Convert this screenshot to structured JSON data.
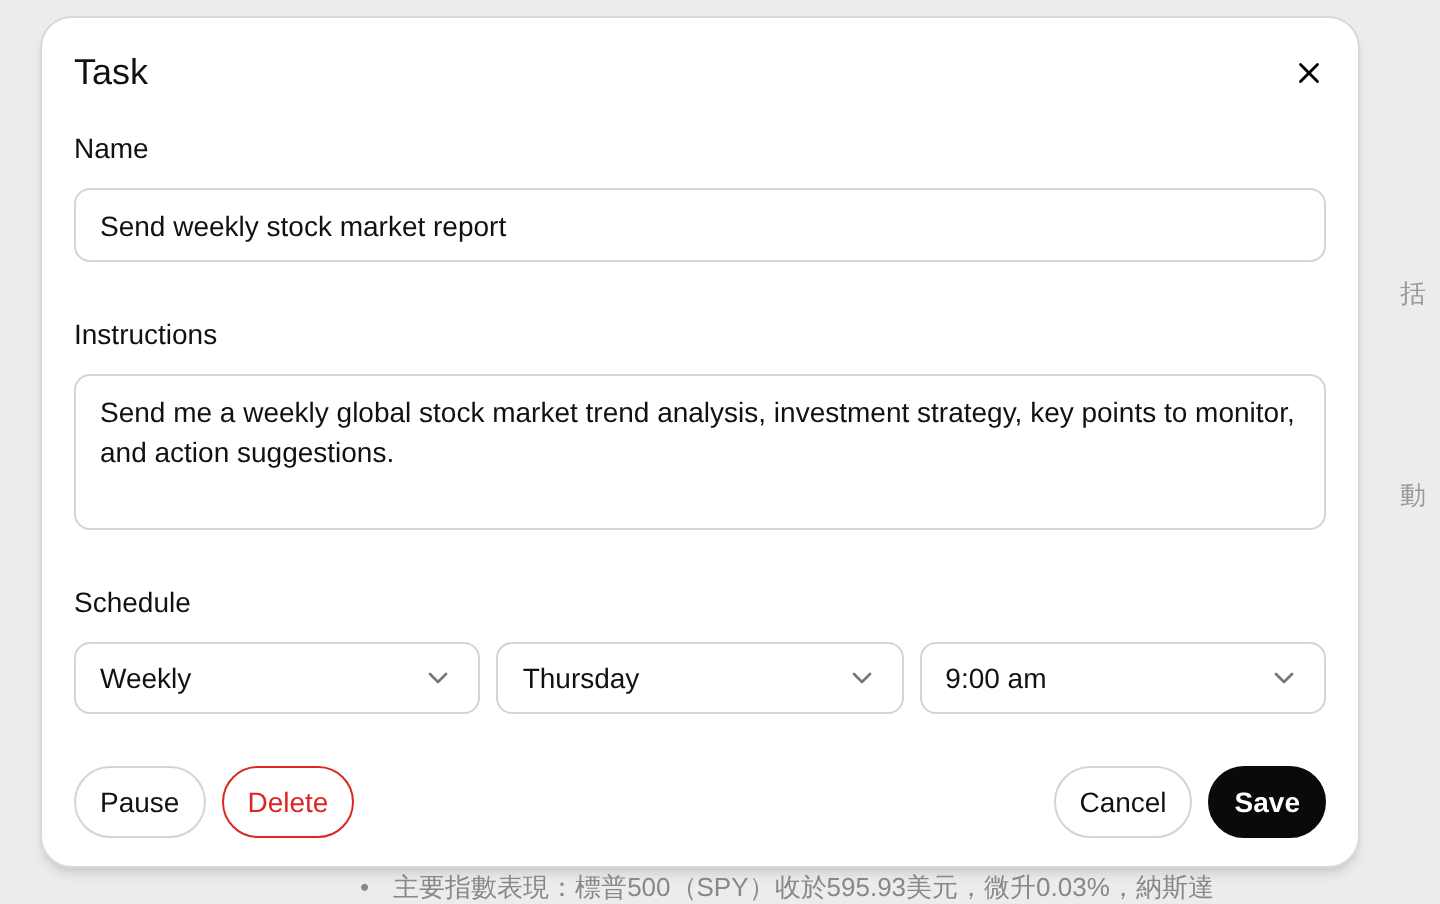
{
  "background": {
    "side_fragments": [
      "括",
      "動"
    ],
    "bullet": "•",
    "line": "主要指數表現：標普500（SPY）收於595.93美元，微升0.03%，納斯達"
  },
  "dialog": {
    "title": "Task",
    "name": {
      "label": "Name",
      "value": "Send weekly stock market report"
    },
    "instructions": {
      "label": "Instructions",
      "value": "Send me a weekly global stock market trend analysis, investment strategy, key points to monitor, and action suggestions."
    },
    "schedule": {
      "label": "Schedule",
      "selects": [
        {
          "value": "Weekly"
        },
        {
          "value": "Thursday"
        },
        {
          "value": "9:00 am"
        }
      ]
    },
    "buttons": [
      {
        "label": "Pause",
        "kind": "outline"
      },
      {
        "label": "Delete",
        "kind": "danger"
      },
      {
        "label": "Cancel",
        "kind": "outline"
      },
      {
        "label": "Save",
        "kind": "primary"
      }
    ]
  }
}
